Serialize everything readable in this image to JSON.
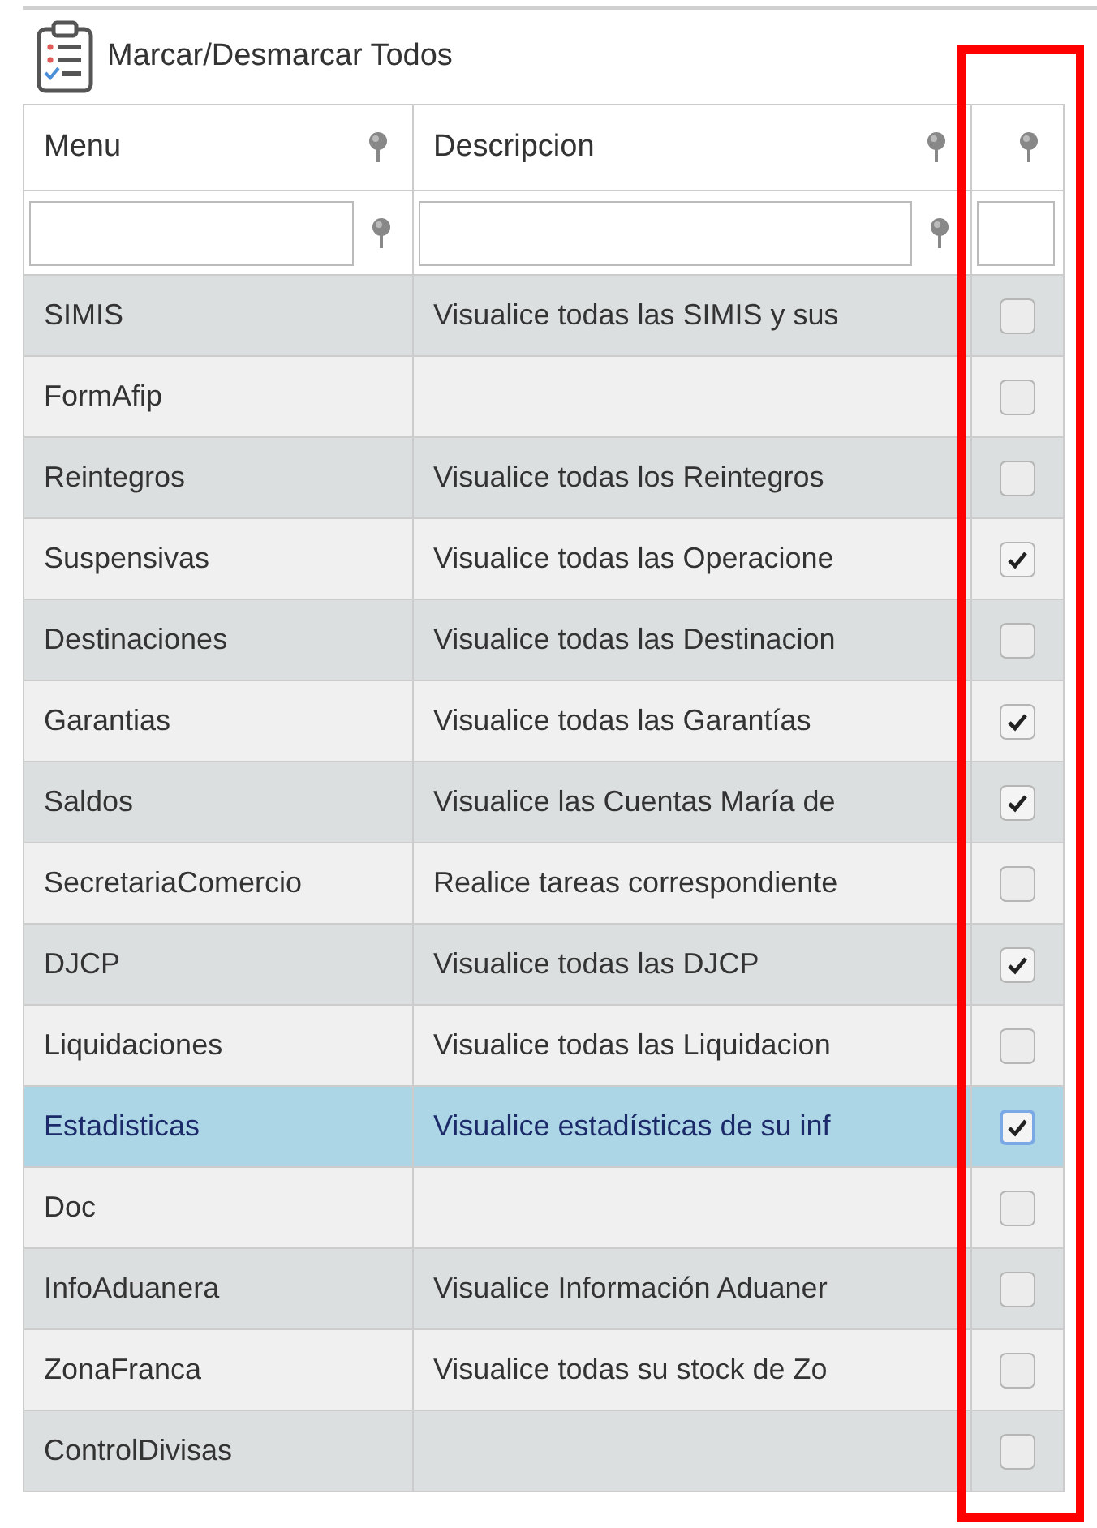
{
  "toolbar": {
    "label": "Marcar/Desmarcar Todos"
  },
  "table": {
    "columns": [
      {
        "label": "Menu",
        "kind": "text"
      },
      {
        "label": "Descripcion",
        "kind": "text"
      },
      {
        "kind": "check"
      }
    ],
    "rows": [
      {
        "menu": "SIMIS",
        "description": "Visualice todas las SIMIS y sus",
        "checked": false,
        "selected": false
      },
      {
        "menu": "FormAfip",
        "checked": false,
        "selected": false
      },
      {
        "menu": "Reintegros",
        "description": "Visualice todas los Reintegros",
        "checked": false,
        "selected": false
      },
      {
        "menu": "Suspensivas",
        "description": "Visualice todas las Operacione",
        "checked": true,
        "selected": false
      },
      {
        "menu": "Destinaciones",
        "description": "Visualice todas las Destinacion",
        "checked": false,
        "selected": false
      },
      {
        "menu": "Garantias",
        "description": "Visualice todas las Garantías",
        "checked": true,
        "selected": false
      },
      {
        "menu": "Saldos",
        "description": "Visualice las Cuentas María de",
        "checked": true,
        "selected": false
      },
      {
        "menu": "SecretariaComercio",
        "description": "Realice tareas correspondiente",
        "checked": false,
        "selected": false
      },
      {
        "menu": "DJCP",
        "description": "Visualice todas las DJCP",
        "checked": true,
        "selected": false
      },
      {
        "menu": "Liquidaciones",
        "description": "Visualice todas las Liquidacion",
        "checked": false,
        "selected": false
      },
      {
        "menu": "Estadisticas",
        "description": "Visualice estadísticas de su inf",
        "checked": true,
        "selected": true
      },
      {
        "menu": "Doc",
        "checked": false,
        "selected": false
      },
      {
        "menu": "InfoAduanera",
        "description": "Visualice Información Aduaner",
        "checked": false,
        "selected": false
      },
      {
        "menu": "ZonaFranca",
        "description": "Visualice todas su stock de Zo",
        "checked": false,
        "selected": false
      },
      {
        "menu": "ControlDivisas",
        "checked": false,
        "selected": false
      }
    ]
  },
  "annotation": {
    "kind": "frame"
  }
}
